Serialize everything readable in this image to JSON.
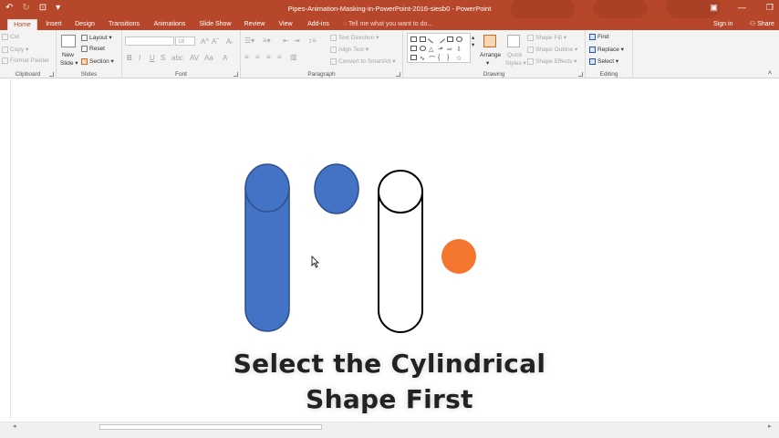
{
  "app": {
    "title": "Pipes-Animation-Masking-in-PowerPoint-2016-siesb0 - PowerPoint",
    "signin": "Sign in",
    "share": "Share",
    "tell_me": "Tell me what you want to do..."
  },
  "tabs": [
    "Home",
    "Insert",
    "Design",
    "Transitions",
    "Animations",
    "Slide Show",
    "Review",
    "View",
    "Add-ins"
  ],
  "active_tab": "Home",
  "ribbon": {
    "clipboard": {
      "label": "Clipboard",
      "cut": "Cut",
      "copy": "Copy",
      "format_painter": "Format Painter"
    },
    "slides": {
      "label": "Slides",
      "new_slide": "New",
      "new_slide2": "Slide",
      "layout": "Layout",
      "reset": "Reset",
      "section": "Section"
    },
    "font": {
      "label": "Font",
      "font_size": "18"
    },
    "paragraph": {
      "label": "Paragraph",
      "text_direction": "Text Direction",
      "align_text": "Align Text",
      "convert_smartart": "Convert to SmartArt"
    },
    "drawing": {
      "label": "Drawing",
      "arrange": "Arrange",
      "quick_styles": "Quick",
      "quick_styles2": "Styles",
      "shape_fill": "Shape Fill",
      "shape_outline": "Shape Outline",
      "shape_effects": "Shape Effects"
    },
    "editing": {
      "label": "Editing",
      "find": "Find",
      "replace": "Replace",
      "select": "Select"
    }
  },
  "slide": {
    "caption_line1": "Select the Cylindrical",
    "caption_line2": "Shape First"
  },
  "colors": {
    "accent": "#b7472a",
    "shape_blue": "#4472c4",
    "shape_blue_stroke": "#2f528f",
    "shape_orange": "#f5762f"
  }
}
